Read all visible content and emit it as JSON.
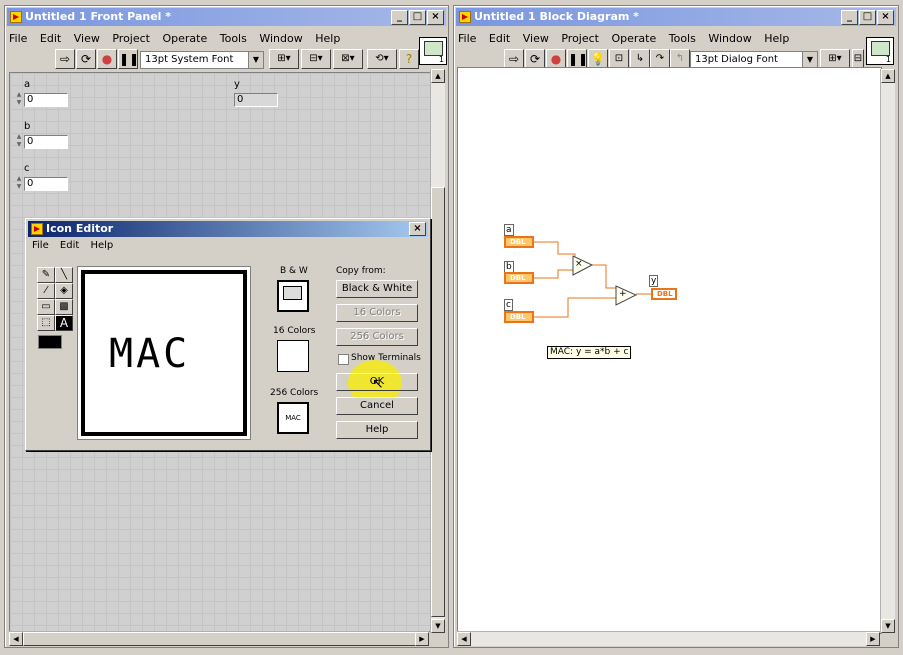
{
  "front_panel": {
    "title": "Untitled 1 Front Panel *",
    "menus": [
      "File",
      "Edit",
      "View",
      "Project",
      "Operate",
      "Tools",
      "Window",
      "Help"
    ],
    "font_selector": "13pt System Font",
    "connector_number": "1",
    "controls": [
      {
        "label": "a",
        "value": "0"
      },
      {
        "label": "b",
        "value": "0"
      },
      {
        "label": "c",
        "value": "0"
      }
    ],
    "indicator": {
      "label": "y",
      "value": "0"
    }
  },
  "block_diagram": {
    "title": "Untitled 1 Block Diagram *",
    "menus": [
      "File",
      "Edit",
      "View",
      "Project",
      "Operate",
      "Tools",
      "Window",
      "Help"
    ],
    "font_selector": "13pt Dialog Font",
    "connector_number": "1",
    "terminals": [
      {
        "label": "a",
        "type": "DBL"
      },
      {
        "label": "b",
        "type": "DBL"
      },
      {
        "label": "c",
        "type": "DBL"
      }
    ],
    "output_terminal": {
      "label": "y",
      "type": "DBL"
    },
    "multiply_symbol": "×",
    "add_symbol": "+",
    "comment": "MAC: y = a*b + c"
  },
  "icon_editor": {
    "title": "Icon Editor",
    "menus": [
      "File",
      "Edit",
      "Help"
    ],
    "canvas_text": "MAC",
    "bw_label": "B & W",
    "colors16_label": "16 Colors",
    "colors256_label": "256 Colors",
    "preview_text": "MAC",
    "copy_from_label": "Copy from:",
    "buttons": {
      "black_white": "Black & White",
      "colors16": "16 Colors",
      "colors256": "256 Colors",
      "ok": "OK",
      "cancel": "Cancel",
      "help": "Help"
    },
    "show_terminals_label": "Show Terminals",
    "tool_text_glyph": "A"
  },
  "colors": {
    "titlebar_inactive": "#7a96df",
    "titlebar_active": "#0a246a",
    "terminal_orange": "#e8751a",
    "cursor_highlight": "#f5ea14"
  }
}
